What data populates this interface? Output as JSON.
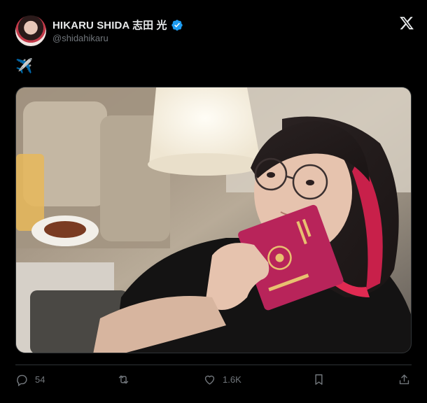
{
  "author": {
    "display_name": "HIKARU SHIDA 志田 光",
    "handle": "@shidahikaru",
    "verified_icon": "verified-badge-icon",
    "verified_color": "#1d9bf0"
  },
  "brand_icon": "x-logo-icon",
  "tweet": {
    "text": "✈️"
  },
  "media": {
    "icon": "photo"
  },
  "actions": {
    "reply_count": "54",
    "repost_count": "",
    "like_count": "1.6K",
    "reply_icon": "reply-icon",
    "repost_icon": "repost-icon",
    "like_icon": "like-icon",
    "bookmark_icon": "bookmark-icon",
    "share_icon": "share-icon"
  },
  "colors": {
    "background": "#000000",
    "text": "#e7e9ea",
    "muted": "#71767b",
    "accent": "#1d9bf0",
    "passport": "#b8245a"
  }
}
